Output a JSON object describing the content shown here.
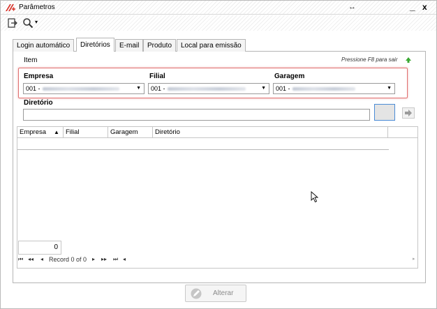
{
  "window": {
    "title": "Parâmetros",
    "resize_glyph": "↔",
    "minimize_glyph": "_",
    "close_glyph": "x",
    "logo_icon": "app-logo"
  },
  "toolbar": {
    "exit_icon": "exit-icon",
    "search_icon": "search-icon",
    "dropdown_glyph": "▾"
  },
  "tabs": [
    {
      "label": "Login automático"
    },
    {
      "label": "Diretórios"
    },
    {
      "label": "E-mail"
    },
    {
      "label": "Produto"
    },
    {
      "label": "Local para emissão"
    }
  ],
  "panel": {
    "item_label": "Item",
    "hint": "Pressione F8 para sair",
    "empresa_label": "Empresa",
    "empresa_value": "001 -",
    "filial_label": "Filial",
    "filial_value": "001 -",
    "garagem_label": "Garagem",
    "garagem_value": "001 -",
    "diretorio_label": "Diretório",
    "diretorio_value": ""
  },
  "grid": {
    "columns": [
      "Empresa",
      "Filial",
      "Garagem",
      "Diretório"
    ],
    "sort_glyph": "▲",
    "record_count": "0",
    "record_text": "Record 0 of 0"
  },
  "buttons": {
    "alterar": "Alterar"
  },
  "colors": {
    "highlight": "#e07070",
    "focus_blue": "#4a8bd6",
    "green_arrow": "#3aa832",
    "logo_red": "#d9342b"
  }
}
